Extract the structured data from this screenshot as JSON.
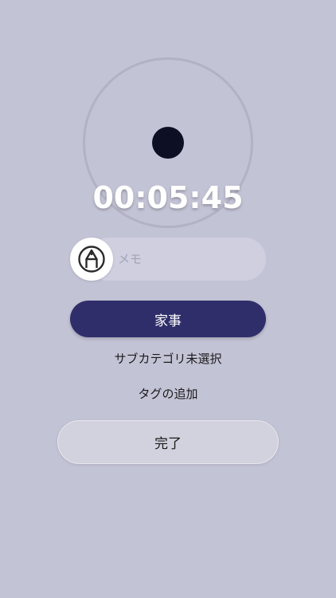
{
  "timer": {
    "elapsed": "00:05:45"
  },
  "memo": {
    "placeholder": "メモ",
    "value": "",
    "icon": "pen-icon"
  },
  "category": {
    "label": "家事"
  },
  "subcategory": {
    "label": "サブカテゴリ未選択"
  },
  "tags": {
    "add_label": "タグの追加"
  },
  "actions": {
    "done_label": "完了"
  },
  "colors": {
    "background": "#c3c3d6",
    "category_button": "#2f2e6a",
    "dial_ring": "#b2b2c4",
    "dial_dot": "#0d0f24"
  }
}
